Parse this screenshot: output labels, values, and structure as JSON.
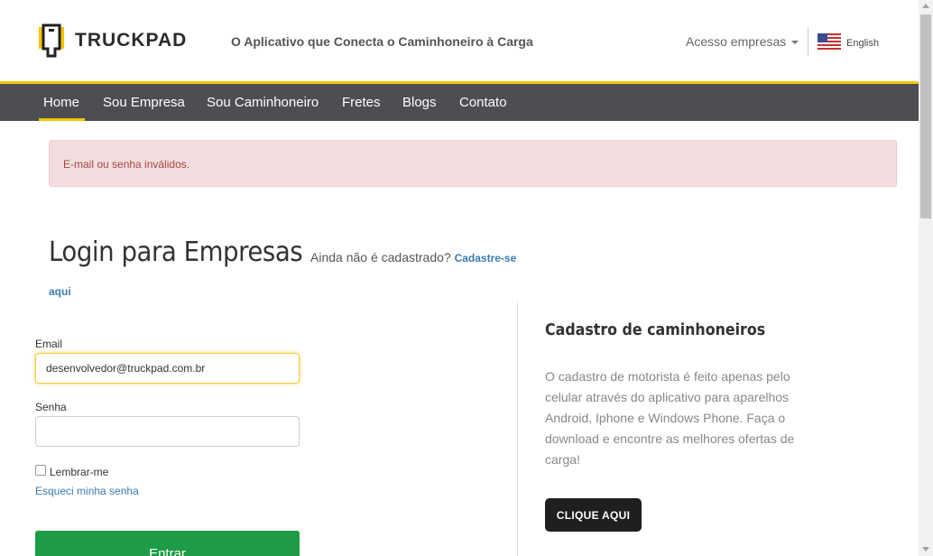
{
  "header": {
    "brand": "TRUCKPAD",
    "tagline": "O Aplicativo que Conecta o Caminhoneiro à Carga",
    "acesso_label": "Acesso empresas",
    "language_label": "English"
  },
  "nav": {
    "items": [
      {
        "label": "Home",
        "active": true
      },
      {
        "label": "Sou Empresa",
        "active": false
      },
      {
        "label": "Sou Caminhoneiro",
        "active": false
      },
      {
        "label": "Fretes",
        "active": false
      },
      {
        "label": "Blogs",
        "active": false
      },
      {
        "label": "Contato",
        "active": false
      }
    ]
  },
  "alert": {
    "message": "E-mail ou senha inválidos."
  },
  "login": {
    "title": "Login para Empresas",
    "not_registered": "Ainda não é cadastrado?",
    "register_link": "Cadastre-se",
    "register_link_2": "aqui",
    "email_label": "Email",
    "email_value": "desenvolvedor@truckpad.com.br",
    "password_label": "Senha",
    "password_value": "",
    "remember_label": "Lembrar-me",
    "forgot_label": "Esqueci minha senha",
    "submit_label": "Entrar"
  },
  "drivers": {
    "title": "Cadastro de caminhoneiros",
    "text": "O cadastro de motorista é feito apenas pelo celular através do aplicativo para aparelhos Android, Iphone e Windows Phone. Faça o download e encontre as melhores ofertas de carga!",
    "button_label": "CLIQUE AQUI"
  },
  "colors": {
    "accent_yellow": "#f5c400",
    "nav_bg": "#4d4e53",
    "alert_bg": "#f2dede",
    "alert_text": "#a94442",
    "link": "#3a7bb3",
    "submit_green": "#1e9b45"
  },
  "icons": {
    "logo": "truckpad-logo-icon",
    "flag": "us-flag-icon",
    "caret": "caret-down-icon"
  }
}
